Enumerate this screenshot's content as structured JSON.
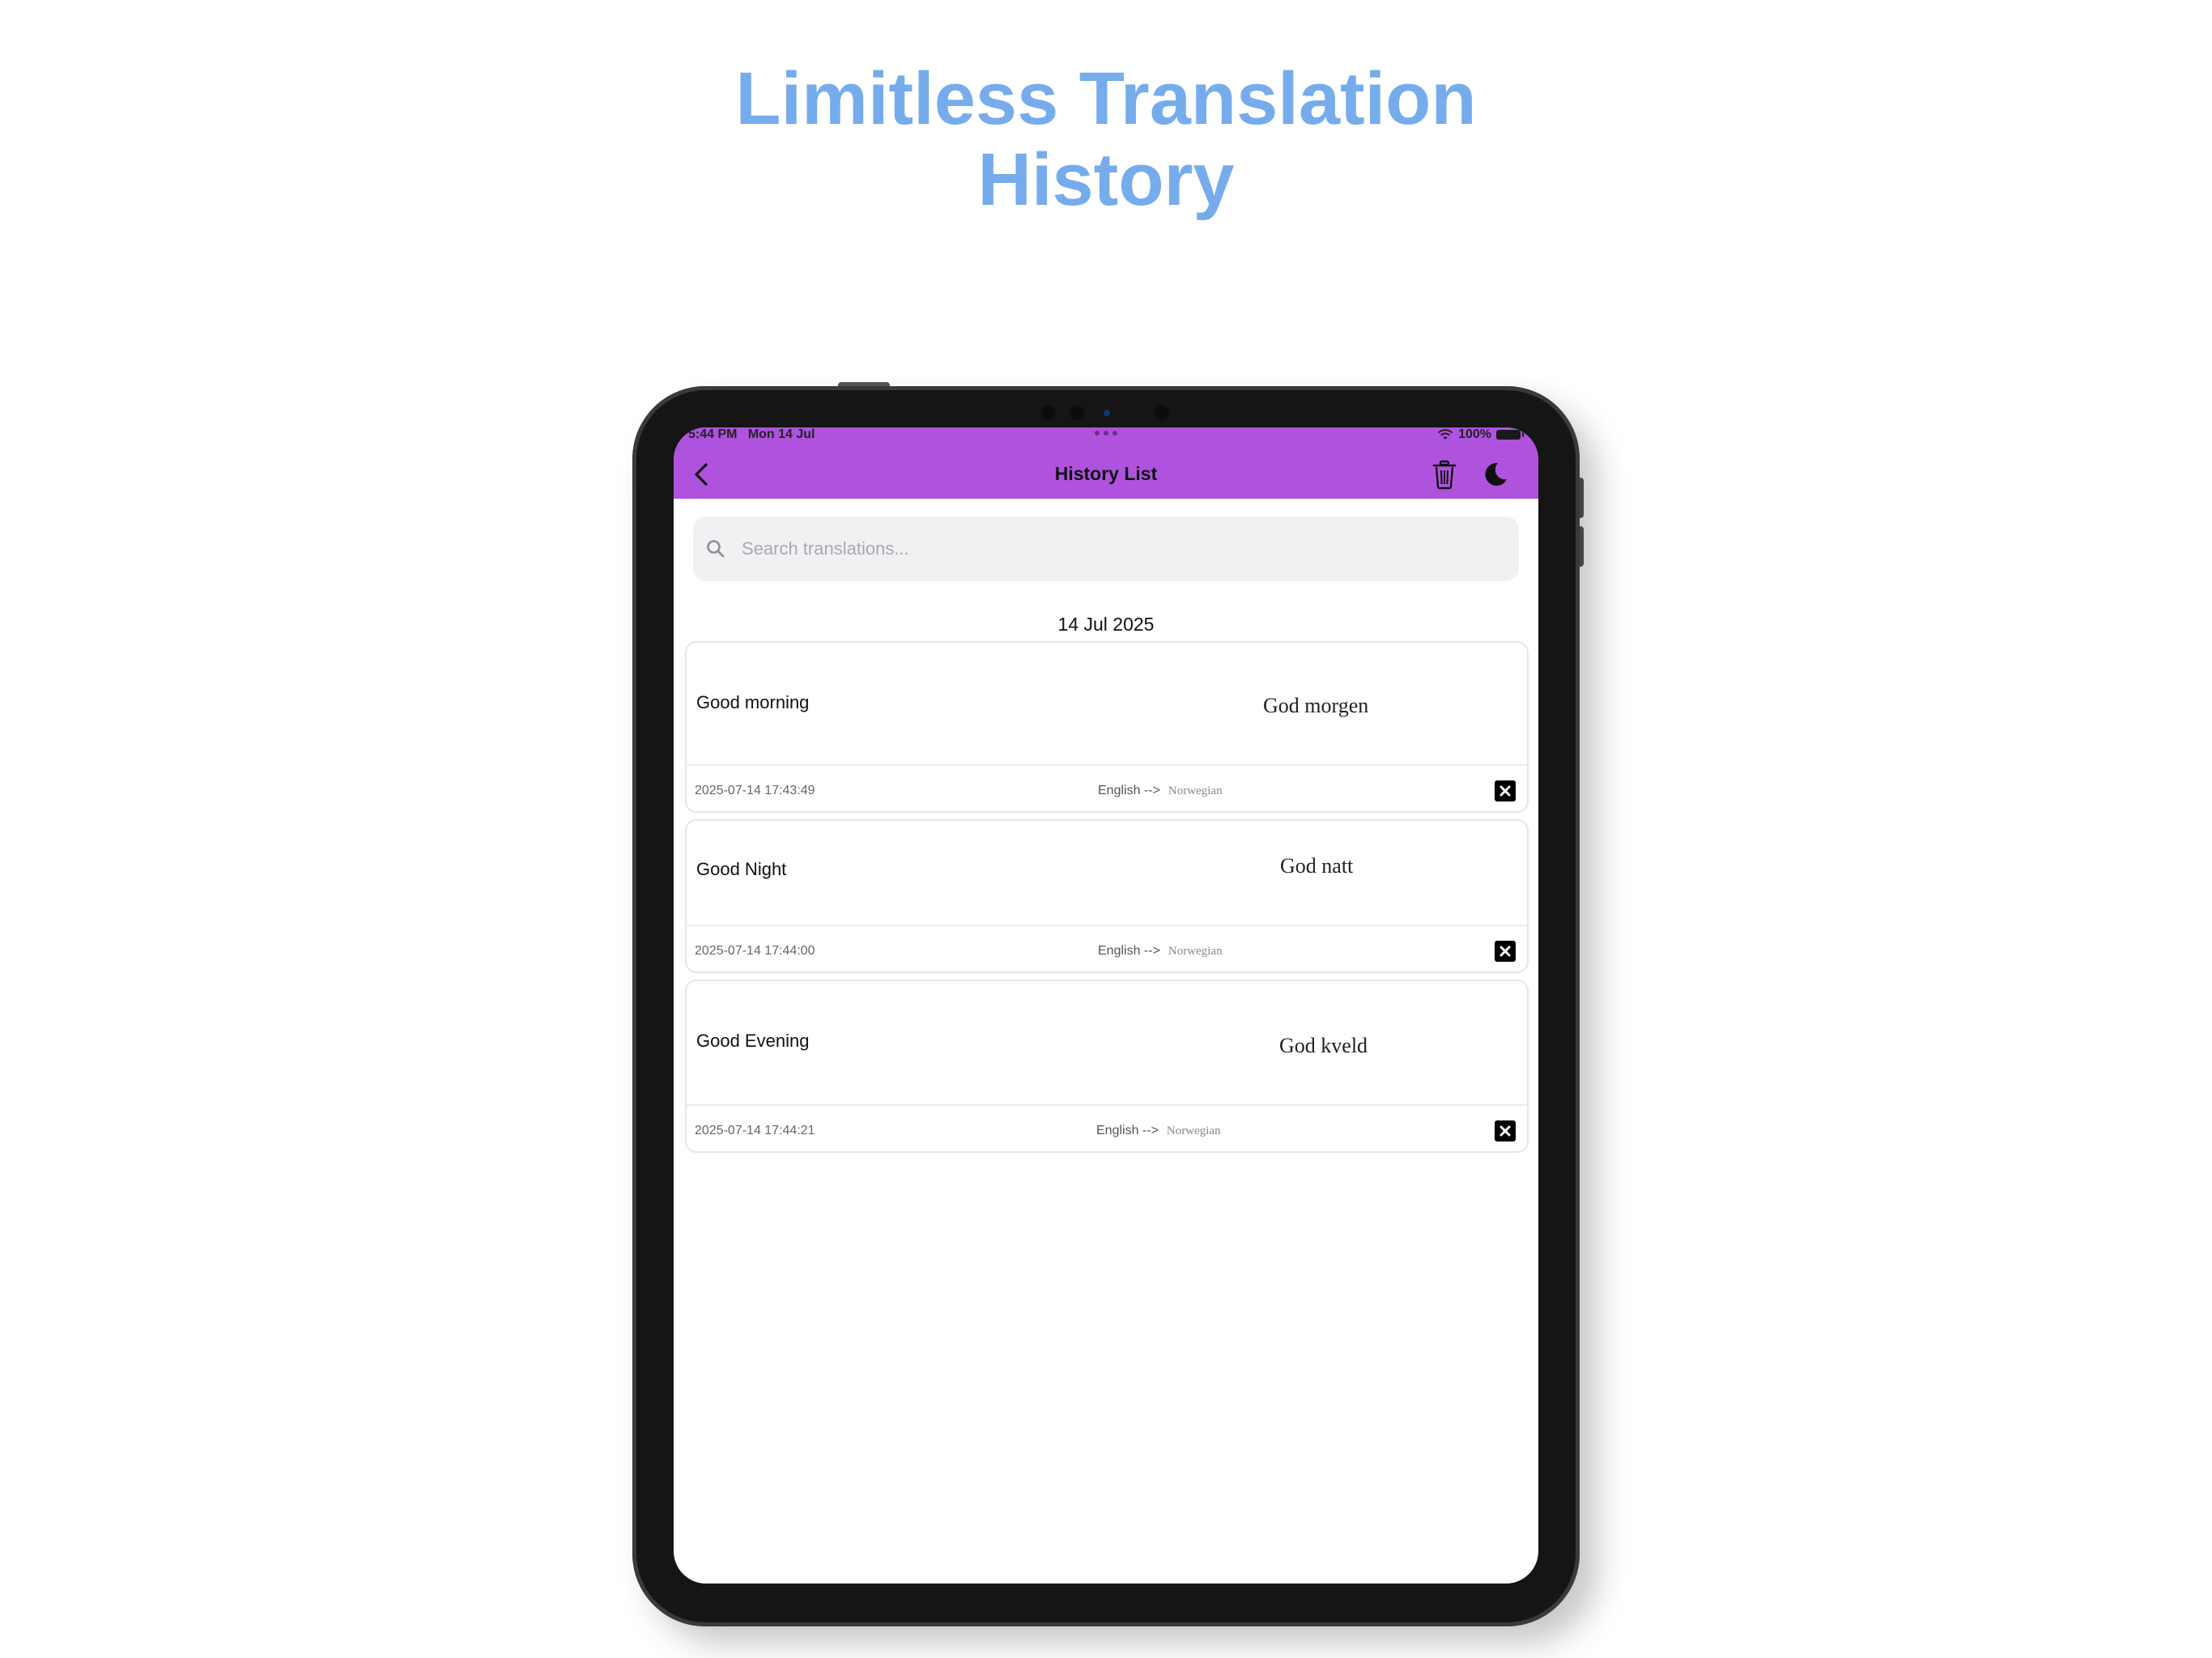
{
  "headline": {
    "line1": "Limitless Translation",
    "line2": "History"
  },
  "status_bar": {
    "time": "5:44 PM",
    "date": "Mon 14 Jul",
    "battery": "100%"
  },
  "app_bar": {
    "title": "History List",
    "back_icon": "chevron-left-icon",
    "delete_all_icon": "trash-icon",
    "theme_icon": "moon-icon",
    "background_color": "#af52de"
  },
  "search": {
    "placeholder": "Search translations...",
    "value": ""
  },
  "section_date": "14 Jul 2025",
  "entries": [
    {
      "source": "Good morning",
      "target": "God morgen",
      "timestamp": "2025-07-14 17:43:49",
      "from_lang": "English -->",
      "to_lang": "Norwegian"
    },
    {
      "source": "Good Night",
      "target": "God natt",
      "timestamp": "2025-07-14 17:44:00",
      "from_lang": "English -->",
      "to_lang": "Norwegian"
    },
    {
      "source": "Good Evening",
      "target": "God kveld",
      "timestamp": "2025-07-14 17:44:21",
      "from_lang": "English -->",
      "to_lang": "Norwegian"
    }
  ],
  "colors": {
    "headline": "#76acec",
    "accent": "#af52de"
  }
}
